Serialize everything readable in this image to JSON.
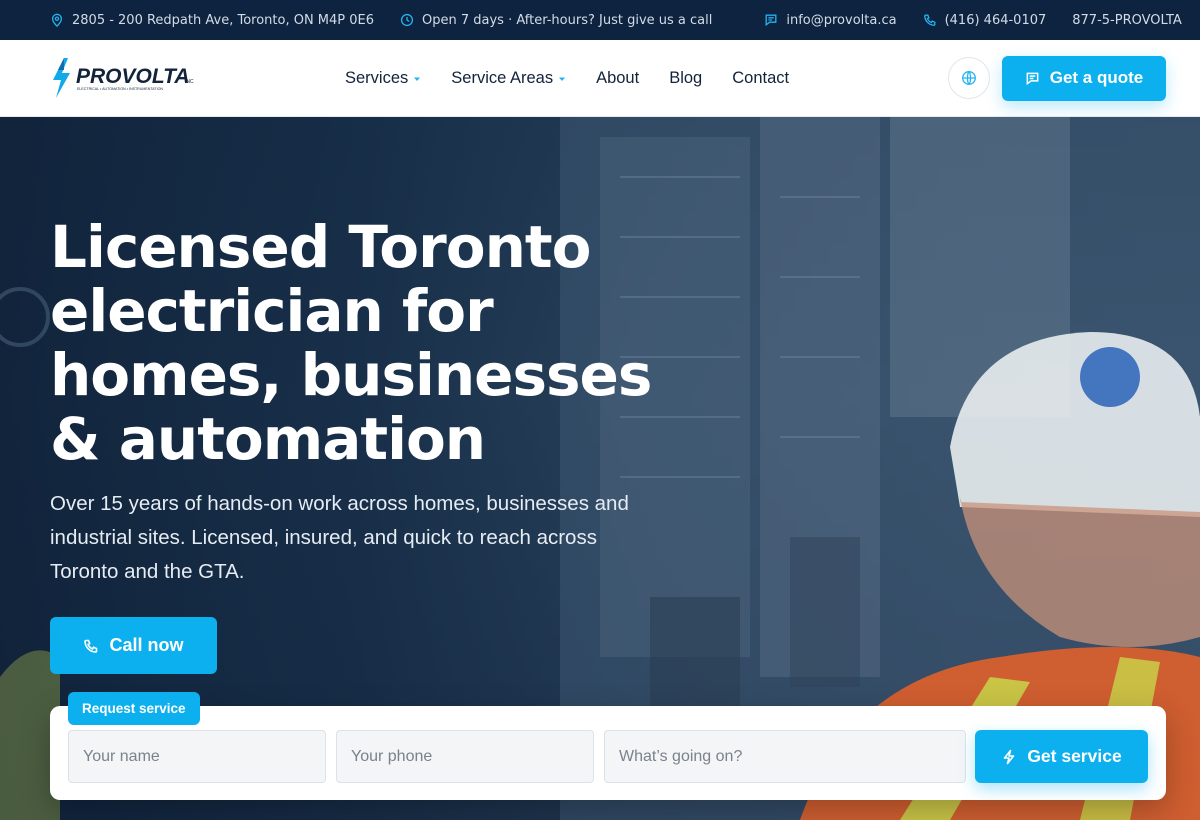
{
  "topbar": {
    "address": "2805 - 200 Redpath Ave, Toronto, ON M4P 0E6",
    "hours": "Open 7 days · After-hours? Just give us a call",
    "email": "info@provolta.ca",
    "phone": "(416) 464-0107",
    "tollfree": "877-5-PROVOLTA"
  },
  "header": {
    "logo_text": "PROVOLTA",
    "logo_suffix": "INC",
    "logo_tagline": "ELECTRICAL • AUTOMATION • INSTRUMENTATION",
    "nav": [
      {
        "label": "Services",
        "has_dropdown": true
      },
      {
        "label": "Service Areas",
        "has_dropdown": true
      },
      {
        "label": "About",
        "has_dropdown": false
      },
      {
        "label": "Blog",
        "has_dropdown": false
      },
      {
        "label": "Contact",
        "has_dropdown": false
      }
    ],
    "quote_label": "Get a quote"
  },
  "hero": {
    "title": "Licensed Toronto electrician for homes, businesses & automation",
    "lede": "Over 15 years of hands-on work across homes, businesses and industrial sites. Licensed, insured, and quick to reach across Toronto and the GTA.",
    "call_label": "Call now"
  },
  "request": {
    "tag": "Request service",
    "name_placeholder": "Your name",
    "phone_placeholder": "Your phone",
    "issue_placeholder": "What’s going on?",
    "submit_label": "Get service"
  },
  "colors": {
    "accent": "#0db0ee",
    "topbar_bg": "#0e2340",
    "nav_text": "#13233a"
  },
  "icons": {
    "address": "map-pin-icon",
    "hours": "clock-icon",
    "email": "message-icon",
    "phone": "phone-icon",
    "language": "globe-icon",
    "quote": "chat-icon",
    "service": "lightning-icon"
  }
}
